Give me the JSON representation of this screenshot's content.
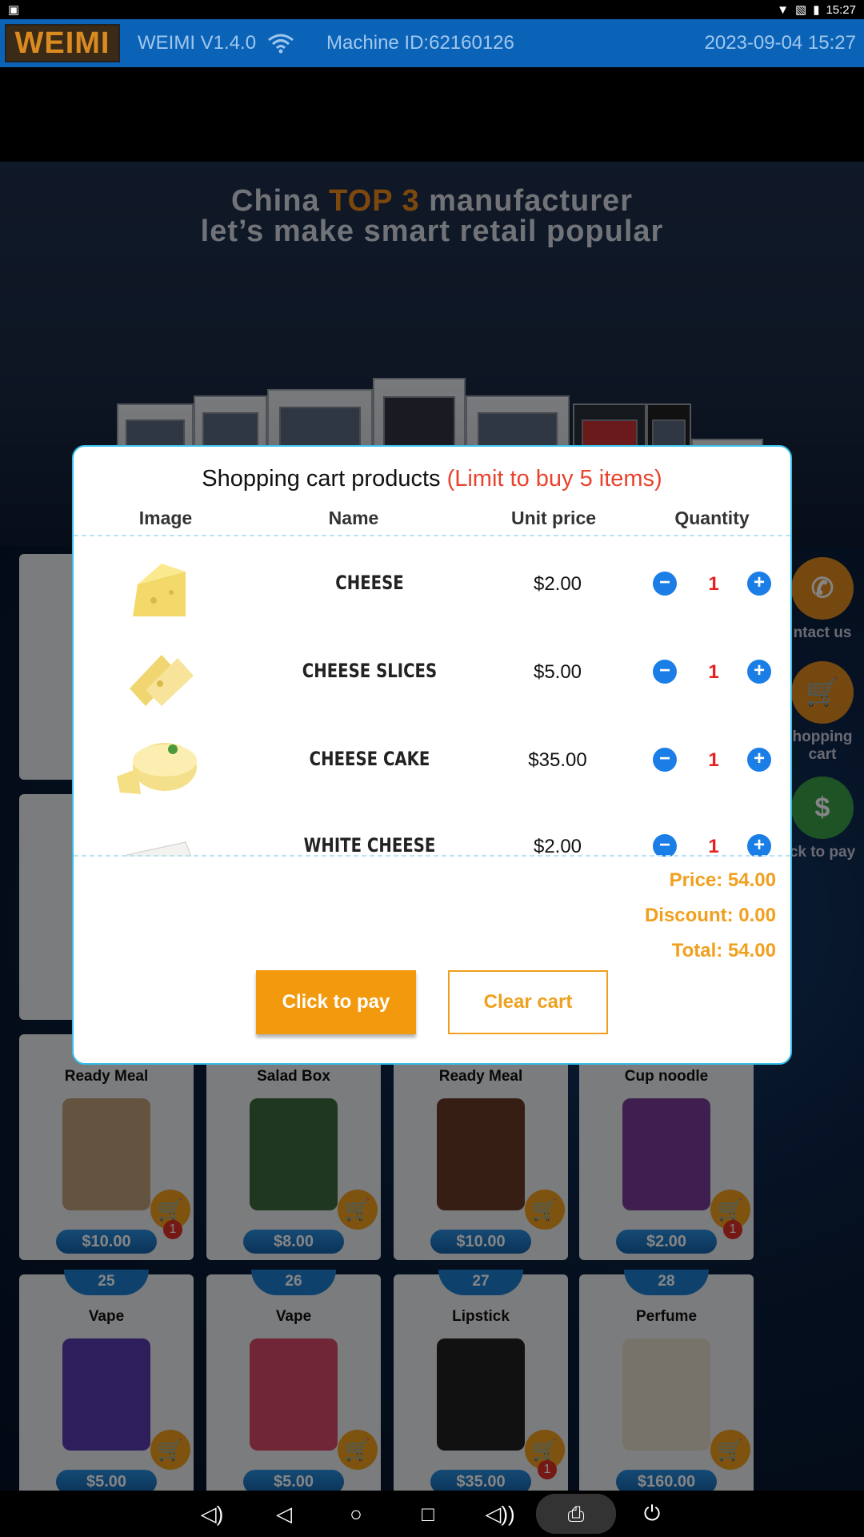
{
  "status_bar": {
    "time": "15:27"
  },
  "header": {
    "logo": "WEIMI",
    "version": "WEIMI V1.4.0",
    "machine_id": "Machine ID:62160126",
    "datetime": "2023-09-04 15:27"
  },
  "banner": {
    "line1_a": "China ",
    "line1_b": "TOP 3",
    "line1_c": " manufacturer",
    "line2": "let’s make smart retail popular"
  },
  "products_bg": [
    {
      "num": "",
      "name": "Ready Meal",
      "price": "$10.00",
      "badge": "1"
    },
    {
      "num": "",
      "name": "Salad Box",
      "price": "$8.00",
      "badge": ""
    },
    {
      "num": "",
      "name": "Ready Meal",
      "price": "$10.00",
      "badge": ""
    },
    {
      "num": "",
      "name": "Cup noodle",
      "price": "$2.00",
      "badge": "1"
    },
    {
      "num": "25",
      "name": "Vape",
      "price": "$5.00",
      "badge": ""
    },
    {
      "num": "26",
      "name": "Vape",
      "price": "$5.00",
      "badge": ""
    },
    {
      "num": "27",
      "name": "Lipstick",
      "price": "$35.00",
      "badge": "1"
    },
    {
      "num": "28",
      "name": "Perfume",
      "price": "$160.00",
      "badge": ""
    }
  ],
  "side_menu": {
    "contact": "ntact us",
    "cart_line1": "hopping",
    "cart_line2": "cart",
    "pay": "ck to pay"
  },
  "modal": {
    "title": "Shopping cart products",
    "limit": "(Limit to buy 5 items)",
    "headers": {
      "image": "Image",
      "name": "Name",
      "unit_price": "Unit price",
      "quantity": "Quantity"
    },
    "items": [
      {
        "name": "CHEESE",
        "price": "$2.00",
        "qty": "1"
      },
      {
        "name": "CHEESE SLICES",
        "price": "$5.00",
        "qty": "1"
      },
      {
        "name": "CHEESE CAKE",
        "price": "$35.00",
        "qty": "1"
      },
      {
        "name": "WHITE CHEESE",
        "price": "$2.00",
        "qty": "1"
      }
    ],
    "price": "Price: 54.00",
    "discount": "Discount: 0.00",
    "total": "Total: 54.00",
    "pay_label": "Click to pay",
    "clear_label": "Clear cart"
  },
  "colors": {
    "accent": "#f0a01e",
    "header": "#0b63b8",
    "modal_border": "#34c0e8",
    "minus_plus": "#1a7ee6"
  }
}
